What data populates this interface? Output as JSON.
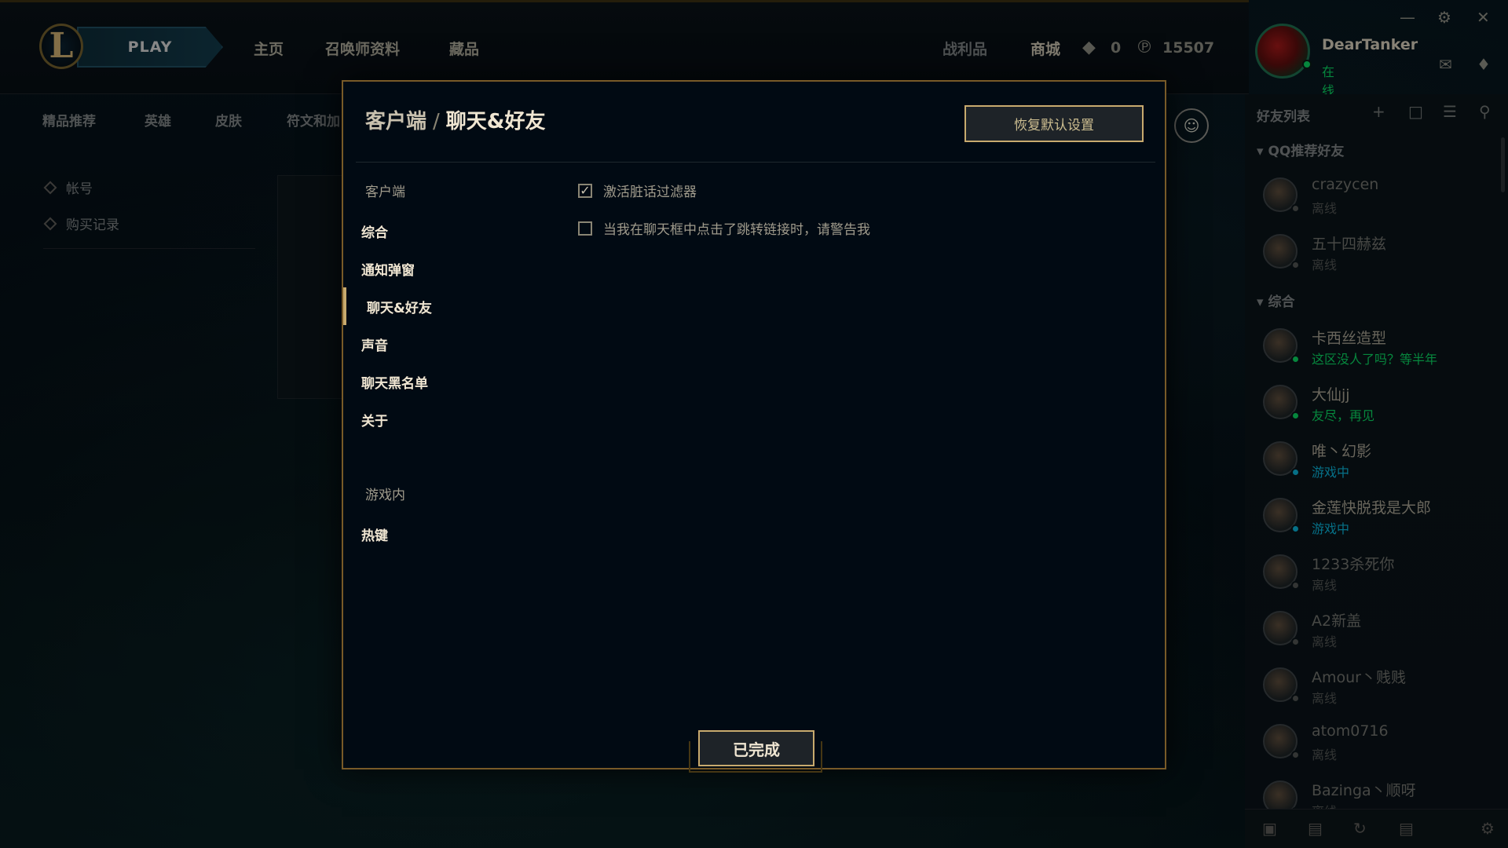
{
  "topbar": {
    "logo_letter": "L",
    "play_label": "PLAY",
    "nav": [
      "主页",
      "召唤师资料",
      "藏品"
    ],
    "loot_label": "战利品",
    "store_label": "商城",
    "rp_value": "0",
    "be_value": "15507"
  },
  "profile": {
    "name": "DearTanker",
    "status": "在线"
  },
  "subnav": [
    "精品推荐",
    "英雄",
    "皮肤",
    "符文和加"
  ],
  "store_side": [
    "帐号",
    "购买记录"
  ],
  "friends": {
    "title": "好友列表",
    "groups": [
      {
        "name": "QQ推荐好友"
      },
      {
        "name": "综合"
      }
    ],
    "list": [
      {
        "name": "crazycen",
        "status": "离线",
        "state": "off"
      },
      {
        "name": "五十四赫兹",
        "status": "离线",
        "state": "off"
      },
      {
        "name": "卡西丝造型",
        "status": "这区没人了吗？等半年",
        "state": "on"
      },
      {
        "name": "大仙jj",
        "status": "友尽，再见",
        "state": "on"
      },
      {
        "name": "唯丶幻影",
        "status": "游戏中",
        "state": "ingame"
      },
      {
        "name": "金莲快脱我是大郎",
        "status": "游戏中",
        "state": "ingame"
      },
      {
        "name": "1233杀死你",
        "status": "离线",
        "state": "off"
      },
      {
        "name": "A2新盖",
        "status": "离线",
        "state": "off"
      },
      {
        "name": "Amour丶贱贱",
        "status": "离线",
        "state": "off"
      },
      {
        "name": "atom0716",
        "status": "离线",
        "state": "off"
      },
      {
        "name": "Bazinga丶顺呀",
        "status": "离线",
        "state": "off"
      }
    ]
  },
  "modal": {
    "crumb_parent": "客户端",
    "crumb_sep": "/",
    "crumb_current": "聊天&好友",
    "reset_label": "恢复默认设置",
    "section_client": "客户端",
    "links": [
      "综合",
      "通知弹窗",
      "聊天&好友",
      "声音",
      "聊天黑名单",
      "关于"
    ],
    "section_ingame": "游戏内",
    "links_ingame": [
      "热键"
    ],
    "options": [
      {
        "label": "激活脏话过滤器",
        "checked": true
      },
      {
        "label": "当我在聊天框中点击了跳转链接时，请警告我",
        "checked": false
      }
    ],
    "done_label": "已完成"
  },
  "colors": {
    "gold": "#c8aa6e",
    "online": "#0acf5e",
    "ingame": "#0aaccf"
  }
}
